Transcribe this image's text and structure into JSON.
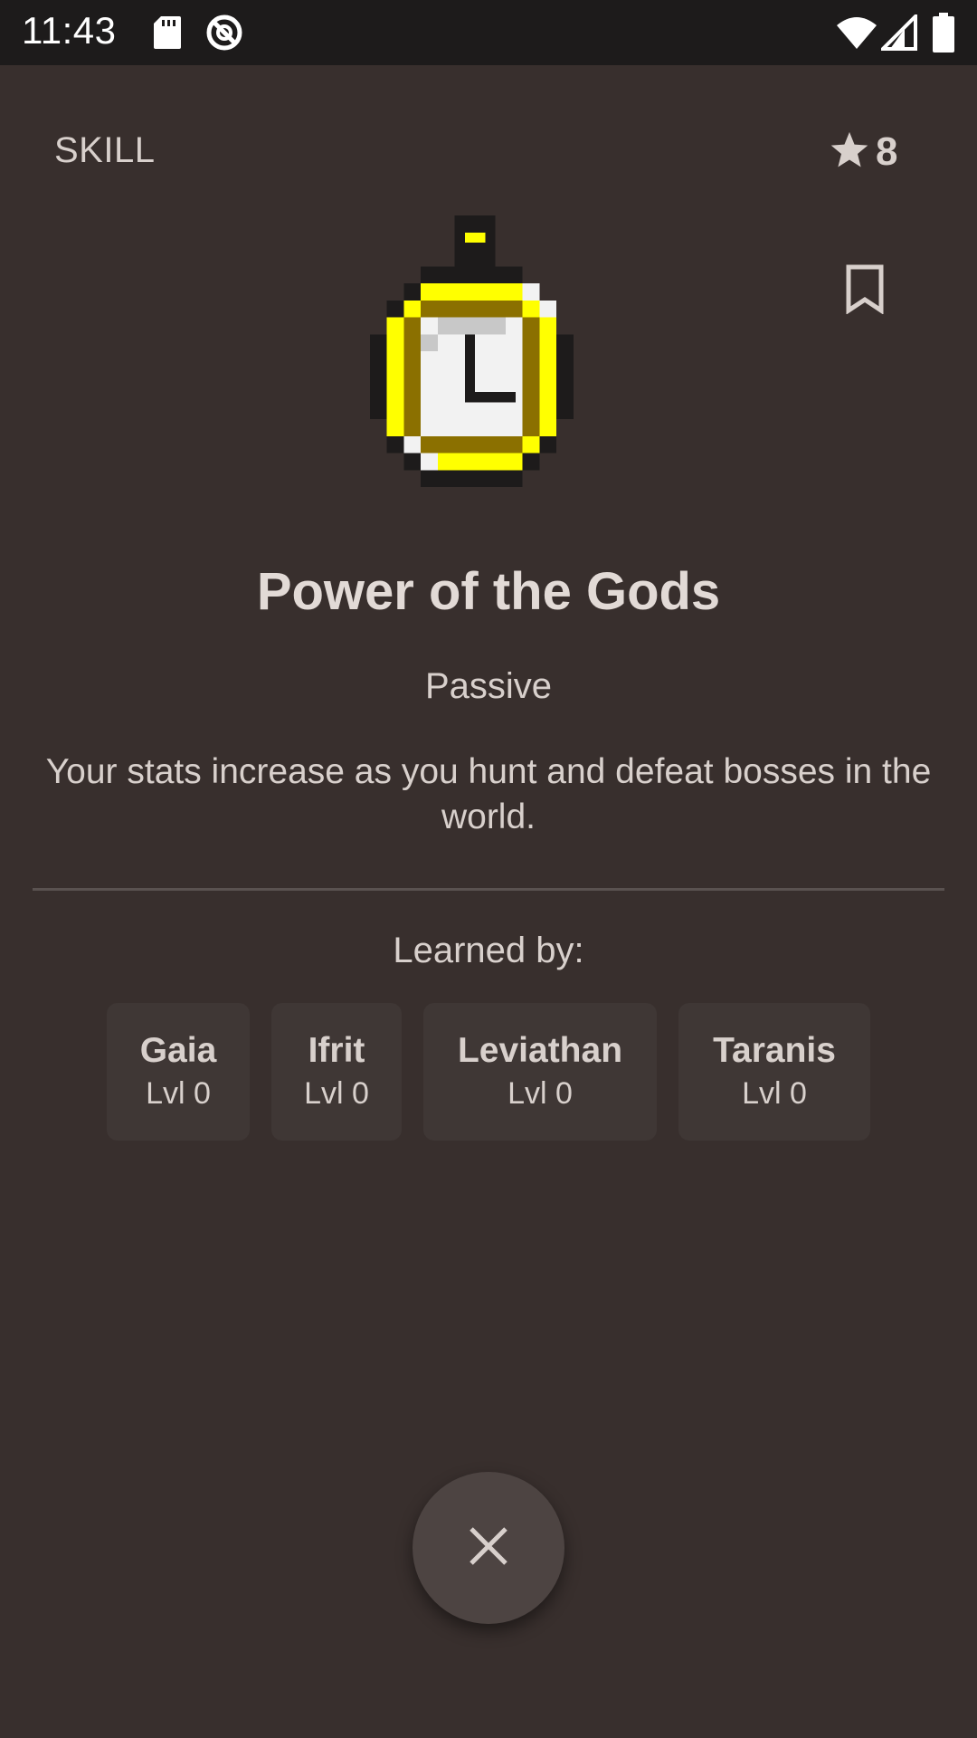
{
  "status_bar": {
    "time": "11:43",
    "icons": [
      "sd-card-icon",
      "no-sync-icon",
      "wifi-icon",
      "cell-signal-icon",
      "battery-icon"
    ]
  },
  "header": {
    "type_label": "SKILL",
    "star_icon": "star-icon",
    "star_count": "8",
    "bookmark_icon": "bookmark-outline-icon"
  },
  "skill": {
    "icon": "stopwatch-icon",
    "name": "Power of the Gods",
    "kind": "Passive",
    "description": "Your stats increase as you hunt and defeat bosses in the world."
  },
  "learned": {
    "label": "Learned by:",
    "characters": [
      {
        "name": "Gaia",
        "level": "Lvl 0"
      },
      {
        "name": "Ifrit",
        "level": "Lvl 0"
      },
      {
        "name": "Leviathan",
        "level": "Lvl 0"
      },
      {
        "name": "Taranis",
        "level": "Lvl 0"
      }
    ]
  },
  "close_icon": "close-icon",
  "colors": {
    "background": "#382f2d",
    "status_bar": "#1d1b1b",
    "card": "#3f3735",
    "text": "#d8d0cc",
    "fab": "#4d4442",
    "icon_yellow": "#ffff00",
    "icon_gold": "#8b7000"
  }
}
